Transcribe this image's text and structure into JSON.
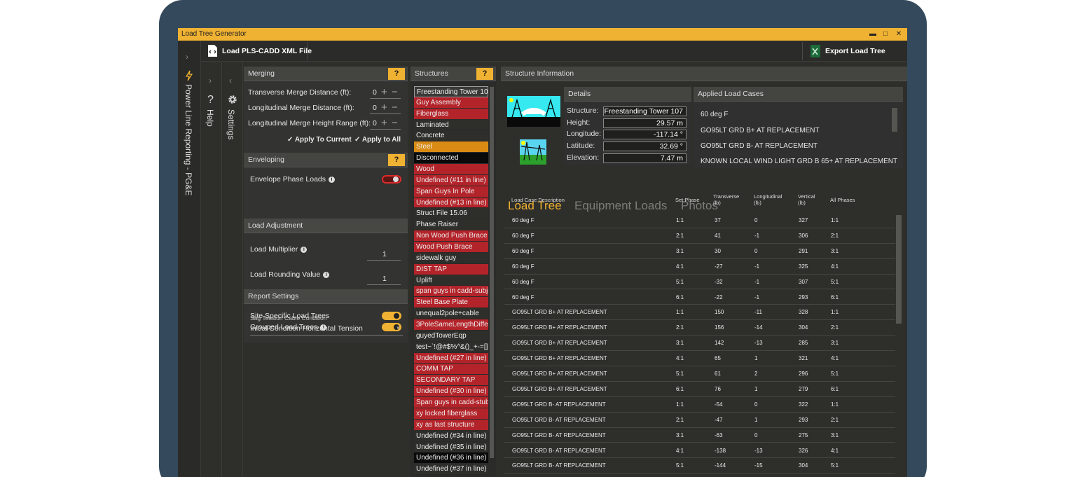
{
  "window": {
    "title": "Load Tree Generator",
    "ctl_min": "▬",
    "ctl_max": "□",
    "ctl_close": "✕"
  },
  "toolbar": {
    "load_label": "Load PLS-CADD XML File",
    "export_label": "Export Load Tree Report"
  },
  "rail": {
    "title": "Power Line Reporting  -  PG&E",
    "help": "Help",
    "settings": "Settings",
    "help_glyph": "?",
    "chev": "›",
    "chev_left": "‹"
  },
  "merging": {
    "title": "Merging",
    "q": "?",
    "rows": [
      {
        "label": "Transverse Merge Distance (ft):",
        "value": "0"
      },
      {
        "label": "Longitudinal Merge Distance (ft):",
        "value": "0"
      },
      {
        "label": "Longitudinal Merge Height Range (ft):",
        "value": "0"
      }
    ],
    "plus": "+",
    "minus": "−",
    "apply_current": "Apply To Current",
    "apply_all": "Apply to All",
    "check": "✓"
  },
  "enveloping": {
    "title": "Enveloping",
    "q": "?",
    "phase_label": "Envelope Phase Loads",
    "info": "i"
  },
  "load_adjustment": {
    "title": "Load Adjustment",
    "multiplier_label": "Load Multiplier",
    "multiplier_value": "1",
    "rounding_label": "Load Rounding Value",
    "rounding_value": "1"
  },
  "report": {
    "title": "Report Settings",
    "site_label": "Site Specific Load Trees",
    "grouped_label": "Grouped Load Trees",
    "sag_label": "Sag Tension Cable Condition",
    "sag_value": "Initial Condition Horizontal Tension",
    "arrow": "▾"
  },
  "structures": {
    "title": "Structures",
    "q": "?",
    "items": [
      {
        "name": "Freestanding Tower 107",
        "style": "sel"
      },
      {
        "name": "Guy Assembly",
        "style": "red"
      },
      {
        "name": "Fiberglass",
        "style": "red"
      },
      {
        "name": "Laminated",
        "style": "dark"
      },
      {
        "name": "Concrete",
        "style": "dark"
      },
      {
        "name": "Steel",
        "style": "orange"
      },
      {
        "name": "Disconnected",
        "style": "black"
      },
      {
        "name": "Wood",
        "style": "red"
      },
      {
        "name": "Undefined (#11 in line)",
        "style": "red"
      },
      {
        "name": "Span Guys In Pole",
        "style": "red"
      },
      {
        "name": "Undefined (#13 in line)",
        "style": "red"
      },
      {
        "name": "Struct File 15.06",
        "style": "dark"
      },
      {
        "name": "Phase Raiser",
        "style": "dark"
      },
      {
        "name": "Non Wood Push Brace",
        "style": "red"
      },
      {
        "name": "Wood Push Brace",
        "style": "red"
      },
      {
        "name": "sidewalk guy",
        "style": "dark"
      },
      {
        "name": "DIST TAP",
        "style": "red"
      },
      {
        "name": "Uplift",
        "style": "dark"
      },
      {
        "name": "span guys in cadd-subject",
        "style": "red"
      },
      {
        "name": "Steel Base Plate",
        "style": "red"
      },
      {
        "name": "unequal2pole+cable",
        "style": "dark"
      },
      {
        "name": "3PoleSameLengthDifferent",
        "style": "red"
      },
      {
        "name": "guyedTowerEqp",
        "style": "dark"
      },
      {
        "name": "test~`!@#$%^&()_+-=[]{}'",
        "style": "dark"
      },
      {
        "name": "Undefined (#27 in line)",
        "style": "red"
      },
      {
        "name": "COMM TAP",
        "style": "red"
      },
      {
        "name": "SECONDARY TAP",
        "style": "red"
      },
      {
        "name": "Undefined (#30 in line)",
        "style": "red"
      },
      {
        "name": "Span guys in cadd-stub",
        "style": "red"
      },
      {
        "name": "xy locked fiberglass",
        "style": "red"
      },
      {
        "name": "xy as last structure",
        "style": "red"
      },
      {
        "name": "Undefined (#34 in line)",
        "style": "dark"
      },
      {
        "name": "Undefined (#35 in line)",
        "style": "dark"
      },
      {
        "name": "Undefined (#36 in line)",
        "style": "black"
      },
      {
        "name": "Undefined (#37 in line)",
        "style": "dark"
      }
    ]
  },
  "info": {
    "title": "Structure Information",
    "details": {
      "title": "Details",
      "rows": [
        {
          "key": "Structure:",
          "value": "Freestanding Tower 107"
        },
        {
          "key": "Height:",
          "value": "29.57 m"
        },
        {
          "key": "Longitude:",
          "value": "-117.14 °"
        },
        {
          "key": "Latitude:",
          "value": "32.69 °"
        },
        {
          "key": "Elevation:",
          "value": "7.47 m"
        }
      ]
    },
    "cases": {
      "title": "Applied Load Cases",
      "items": [
        "60 deg F",
        "GO95LT GRD B+ AT REPLACEMENT",
        "GO95LT GRD B- AT REPLACEMENT",
        "KNOWN LOCAL WIND LIGHT GRD B 65+ AT REPLACEMENT"
      ]
    }
  },
  "tabs": {
    "load_tree": "Load Tree",
    "equipment": "Equipment Loads",
    "photos": "Photos"
  },
  "table": {
    "headers": {
      "desc": "Load Case Description",
      "phase": "Set:Phase",
      "trans": "Transverse\n(lb)",
      "long": "Longitudinal\n(lb)",
      "vert": "Vertical\n(lb)",
      "all": "All Phases"
    },
    "rows": [
      [
        "60 deg F",
        "1:1",
        "37",
        "0",
        "327",
        "1:1"
      ],
      [
        "60 deg F",
        "2:1",
        "41",
        "-1",
        "306",
        "2:1"
      ],
      [
        "60 deg F",
        "3:1",
        "30",
        "0",
        "291",
        "3:1"
      ],
      [
        "60 deg F",
        "4:1",
        "-27",
        "-1",
        "325",
        "4:1"
      ],
      [
        "60 deg F",
        "5:1",
        "-32",
        "-1",
        "307",
        "5:1"
      ],
      [
        "60 deg F",
        "6:1",
        "-22",
        "-1",
        "293",
        "6:1"
      ],
      [
        "GO95LT GRD B+ AT REPLACEMENT",
        "1:1",
        "150",
        "-11",
        "328",
        "1:1"
      ],
      [
        "GO95LT GRD B+ AT REPLACEMENT",
        "2:1",
        "156",
        "-14",
        "304",
        "2:1"
      ],
      [
        "GO95LT GRD B+ AT REPLACEMENT",
        "3:1",
        "142",
        "-13",
        "285",
        "3:1"
      ],
      [
        "GO95LT GRD B+ AT REPLACEMENT",
        "4:1",
        "65",
        "1",
        "321",
        "4:1"
      ],
      [
        "GO95LT GRD B+ AT REPLACEMENT",
        "5:1",
        "61",
        "2",
        "296",
        "5:1"
      ],
      [
        "GO95LT GRD B+ AT REPLACEMENT",
        "6:1",
        "76",
        "1",
        "279",
        "6:1"
      ],
      [
        "GO95LT GRD B- AT REPLACEMENT",
        "1:1",
        "-54",
        "0",
        "322",
        "1:1"
      ],
      [
        "GO95LT GRD B- AT REPLACEMENT",
        "2:1",
        "-47",
        "1",
        "293",
        "2:1"
      ],
      [
        "GO95LT GRD B- AT REPLACEMENT",
        "3:1",
        "-63",
        "0",
        "275",
        "3:1"
      ],
      [
        "GO95LT GRD B- AT REPLACEMENT",
        "4:1",
        "-138",
        "-13",
        "326",
        "4:1"
      ],
      [
        "GO95LT GRD B- AT REPLACEMENT",
        "5:1",
        "-144",
        "-15",
        "304",
        "5:1"
      ]
    ]
  },
  "colors": {
    "accent": "#f0b232",
    "red": "#b3242a",
    "dark_bg": "#2e2e2b",
    "orange": "#d98b14"
  }
}
